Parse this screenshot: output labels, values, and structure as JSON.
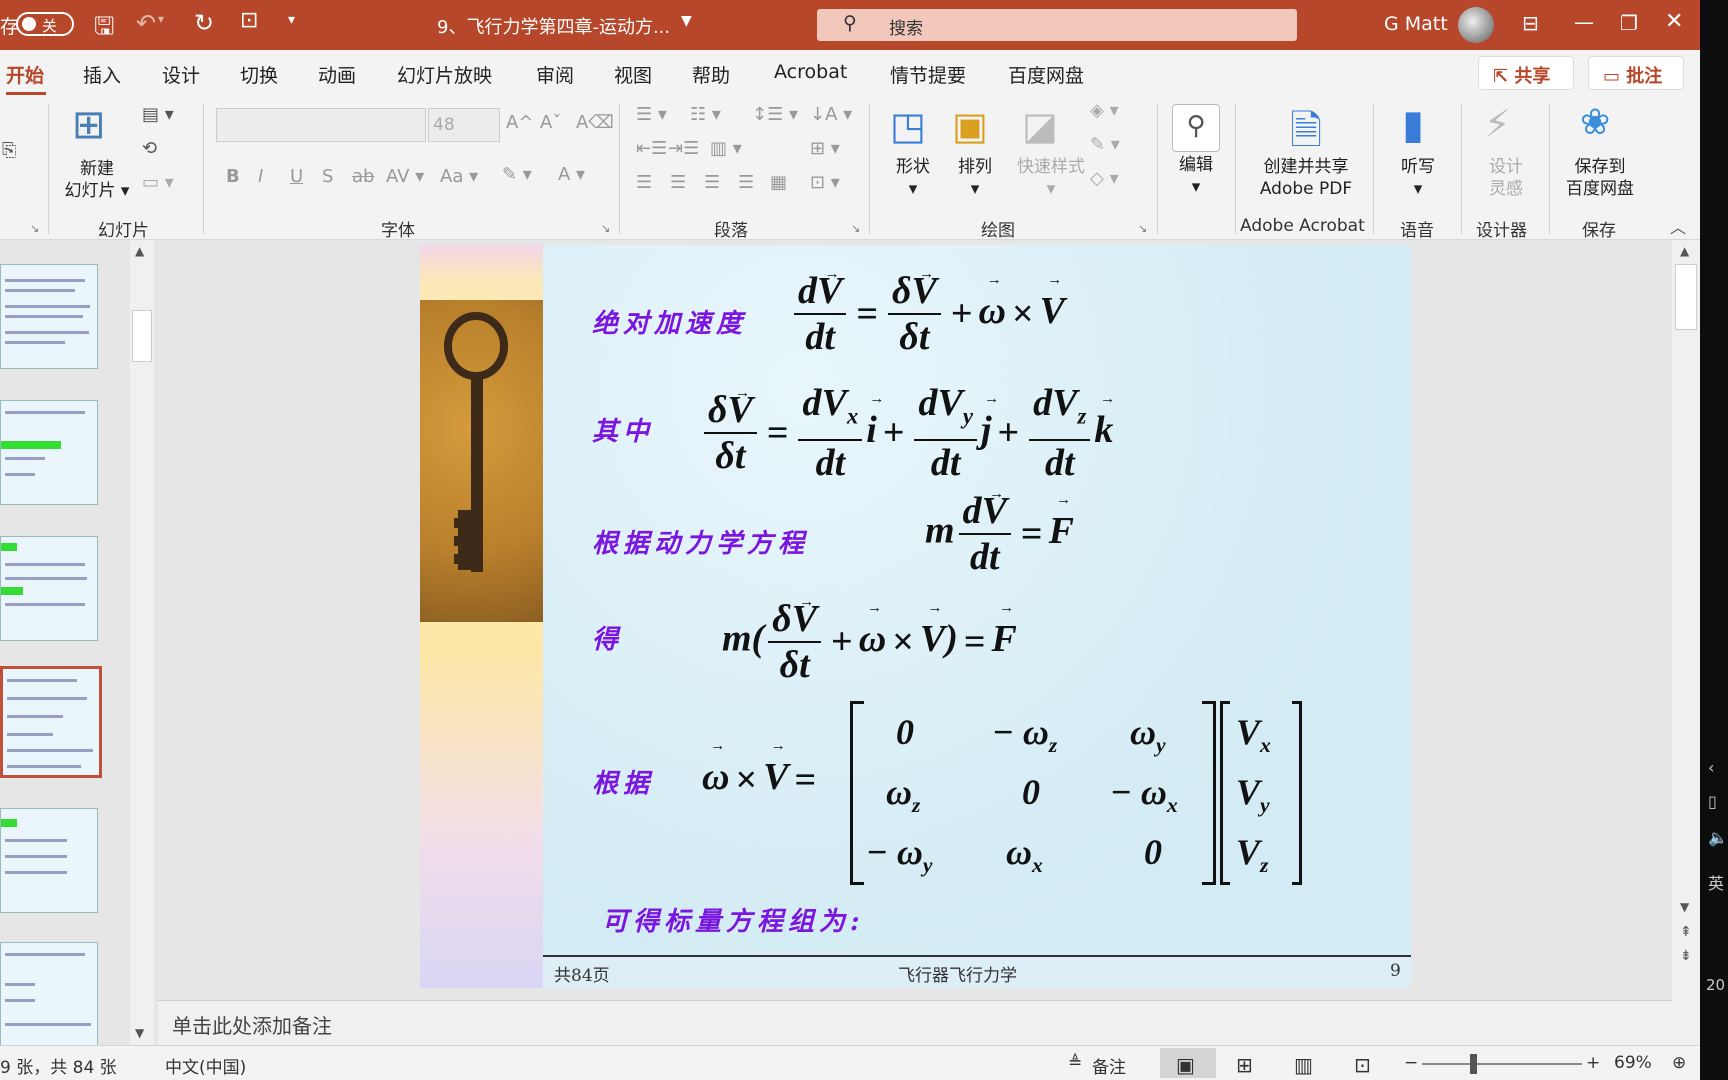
{
  "titlebar": {
    "autosave_prefix": "存",
    "autosave_state": "关",
    "doc_title": "9、飞行力学第四章-运动方...",
    "search_placeholder": "搜索",
    "user": "G Matt"
  },
  "tabs": [
    "开始",
    "插入",
    "设计",
    "切换",
    "动画",
    "幻灯片放映",
    "审阅",
    "视图",
    "帮助",
    "Acrobat",
    "情节提要",
    "百度网盘"
  ],
  "actions": {
    "share": "共享",
    "comment": "批注"
  },
  "ribbon": {
    "new_slide": [
      "新建",
      "幻灯片"
    ],
    "font_size": "48",
    "shape": "形状",
    "arrange": "排列",
    "quick_styles": "快速样式",
    "edit": "编辑",
    "create_pdf": [
      "创建并共享",
      "Adobe PDF"
    ],
    "dictate": "听写",
    "design_ideas": [
      "设计",
      "灵感"
    ],
    "save_to": [
      "保存到",
      "百度网盘"
    ],
    "groups": {
      "slides": "幻灯片",
      "font": "字体",
      "paragraph": "段落",
      "drawing": "绘图",
      "acrobat": "Adobe Acrobat",
      "voice": "语音",
      "designer": "设计器",
      "save": "保存"
    }
  },
  "slide": {
    "labels": {
      "abs_accel": "绝对加速度",
      "where": "其中",
      "by_dynamics": "根据动力学方程",
      "get": "得",
      "by": "根据",
      "scalar": "可得标量方程组为:"
    },
    "footer": {
      "pages": "共84页",
      "course": "飞行器飞行力学",
      "page": "9"
    }
  },
  "notes_placeholder": "单击此处添加备注",
  "status": {
    "slide_count": "9 张，共 84 张",
    "language": "中文(中国)",
    "notes": "备注",
    "zoom": "69%",
    "right_date": "20"
  }
}
